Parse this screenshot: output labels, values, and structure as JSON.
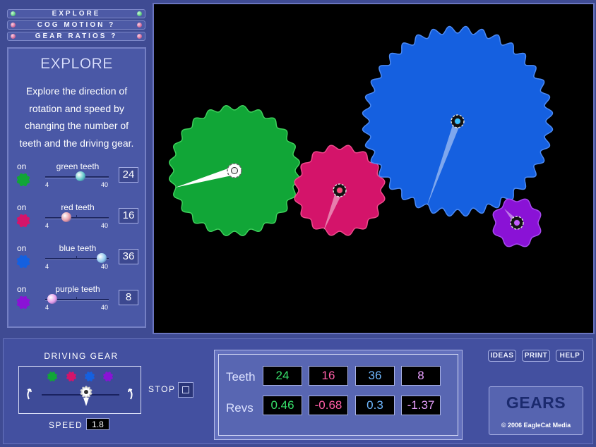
{
  "menu": [
    {
      "label": "EXPLORE",
      "dot": "green"
    },
    {
      "label": "COG MOTION ?",
      "dot": "pink"
    },
    {
      "label": "GEAR RATIOS ?",
      "dot": "pink"
    }
  ],
  "panel": {
    "title": "EXPLORE",
    "description": "Explore the direction of rotation and speed by changing the number of teeth and the driving gear.",
    "sliders": [
      {
        "on_label": "on",
        "name": "green teeth",
        "min": "4",
        "max": "40",
        "value": "24",
        "color": "#11a637",
        "knob_color": "#5fc6c9"
      },
      {
        "on_label": "on",
        "name": "red teeth",
        "min": "4",
        "max": "40",
        "value": "16",
        "color": "#d4146a",
        "knob_color": "#e89aa7"
      },
      {
        "on_label": "on",
        "name": "blue teeth",
        "min": "4",
        "max": "40",
        "value": "36",
        "color": "#1560e0",
        "knob_color": "#8fc8ee"
      },
      {
        "on_label": "on",
        "name": "purple teeth",
        "min": "4",
        "max": "40",
        "value": "8",
        "color": "#8a12d6",
        "knob_color": "#e49ae8"
      }
    ]
  },
  "gears": [
    {
      "name": "green",
      "teeth": 24,
      "color": "#11a637",
      "stroke": "#3ed15c"
    },
    {
      "name": "red",
      "teeth": 16,
      "color": "#d4146a",
      "stroke": "#f04a8c"
    },
    {
      "name": "blue",
      "teeth": 36,
      "color": "#1560e0",
      "stroke": "#4b8af5"
    },
    {
      "name": "purple",
      "teeth": 8,
      "color": "#8a12d6",
      "stroke": "#a84af0"
    }
  ],
  "driving_gear": {
    "label": "DRIVING GEAR",
    "speed_label": "SPEED",
    "speed_value": "1.8",
    "icon_colors": [
      "#11a637",
      "#d4146a",
      "#1560e0",
      "#8a12d6"
    ]
  },
  "stop": {
    "label": "STOP"
  },
  "stats": {
    "teeth_label": "Teeth",
    "revs_label": "Revs",
    "teeth": [
      "24",
      "16",
      "36",
      "8"
    ],
    "revs": [
      "0.46",
      "-0.68",
      "0.3",
      "-1.37"
    ],
    "colors": [
      "#37e06b",
      "#ff5ea6",
      "#6fb8ff",
      "#e9a0ff"
    ]
  },
  "buttons": {
    "ideas": "IDEAS",
    "print": "PRINT",
    "help": "HELP"
  },
  "brand": {
    "title": "GEARS",
    "copyright": "© 2006 EagleCat Media"
  }
}
